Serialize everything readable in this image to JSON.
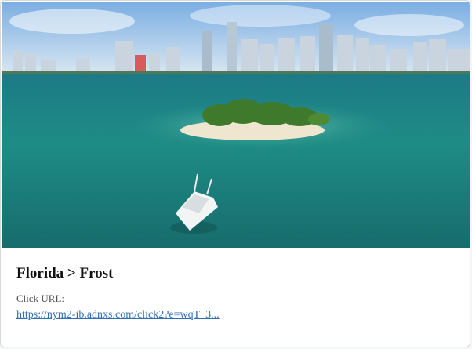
{
  "ad": {
    "image_alt": "Aerial view of a small tropical island with a boat near a city skyline",
    "title": "Florida > Frost",
    "click_url_label": "Click URL:",
    "click_url": "https://nym2-ib.adnxs.com/click2?e=wqT_3..."
  }
}
